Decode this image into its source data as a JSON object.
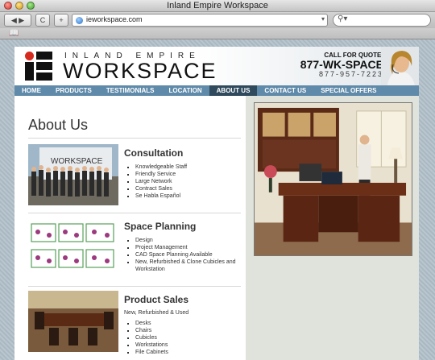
{
  "window": {
    "title": "Inland Empire Workspace"
  },
  "toolbar": {
    "back_label": "◀ ▶",
    "reload_label": "C",
    "add_label": "+",
    "address_value": "ieworkspace.com",
    "search_placeholder": ""
  },
  "header": {
    "brand_top": "INLAND EMPIRE",
    "brand_main": "WORKSPACE",
    "call_label": "CALL FOR QUOTE!",
    "phone_letters": "877-WK-SPACE",
    "phone_digits": "877-957-7223"
  },
  "nav": {
    "items": [
      {
        "label": "HOME"
      },
      {
        "label": "PRODUCTS"
      },
      {
        "label": "TESTIMONIALS"
      },
      {
        "label": "LOCATION"
      },
      {
        "label": "ABOUT US"
      },
      {
        "label": "CONTACT US"
      },
      {
        "label": "SPECIAL OFFERS"
      }
    ],
    "active": "ABOUT US"
  },
  "main": {
    "title": "About Us",
    "sections": [
      {
        "title": "Consultation",
        "bullets": [
          "Knowledgeable Staff",
          "Friendly Service",
          "Large Network",
          "Contract Sales",
          "Se Habla Español"
        ]
      },
      {
        "title": "Space Planning",
        "bullets": [
          "Design",
          "Project Management",
          "CAD Space Planning Available",
          "New, Refurbished & Clone Cubicles and",
          "Workstation"
        ]
      },
      {
        "title": "Product Sales",
        "subtitle": "New, Refurbished & Used",
        "bullets": [
          "Desks",
          "Chairs",
          "Cubicles",
          "Workstations",
          "File Cabinets"
        ]
      }
    ]
  },
  "colors": {
    "nav_bg": "#5f8aa9",
    "nav_active": "#2f4a5c",
    "accent_red": "#d52b1e"
  }
}
